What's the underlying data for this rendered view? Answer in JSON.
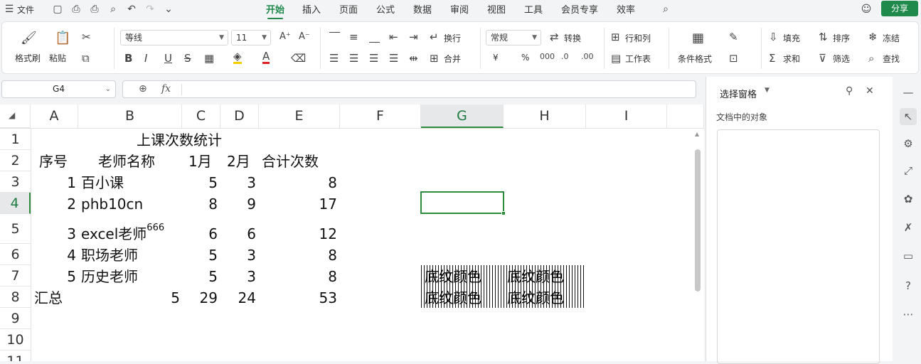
{
  "topbar": {
    "menu_icon": "menu-icon",
    "file_label": "文件",
    "tabs": [
      "开始",
      "插入",
      "页面",
      "公式",
      "数据",
      "审阅",
      "视图",
      "工具",
      "会员专享",
      "效率"
    ],
    "active_tab": "开始",
    "share_label": "分享"
  },
  "ribbon": {
    "format_painter": "格式刷",
    "paste": "粘贴",
    "font_name": "等线",
    "font_size": "11",
    "wrap": "换行",
    "merge": "合并",
    "number_format": "常规",
    "convert": "转换",
    "row_col": "行和列",
    "worksheet": "工作表",
    "cond_format": "条件格式",
    "fill": "填充",
    "sort": "排序",
    "freeze": "冻结",
    "sum": "求和",
    "filter": "筛选",
    "find": "查找",
    "currency": "¥",
    "percent": "%"
  },
  "formula": {
    "cell_ref": "G4",
    "fx": "fx",
    "value": ""
  },
  "sheet": {
    "columns": [
      "A",
      "B",
      "C",
      "D",
      "E",
      "F",
      "G",
      "H",
      "I"
    ],
    "selected_column": "G",
    "rows": [
      "1",
      "2",
      "3",
      "4",
      "5",
      "6",
      "7",
      "8",
      "9",
      "10",
      "11"
    ],
    "selected_row": "4",
    "title": "上课次数统计",
    "headers": [
      "序号",
      "老师名称",
      "1月",
      "2月",
      "合计次数"
    ],
    "data": [
      {
        "no": "1",
        "name": "百小课",
        "m1": "5",
        "m2": "3",
        "total": "8"
      },
      {
        "no": "2",
        "name": "phb10cn",
        "m1": "8",
        "m2": "9",
        "total": "17"
      },
      {
        "no": "3",
        "name": "excel老师",
        "sup": "666",
        "m1": "6",
        "m2": "6",
        "total": "12"
      },
      {
        "no": "4",
        "name": "职场老师",
        "m1": "5",
        "m2": "3",
        "total": "8"
      },
      {
        "no": "5",
        "name": "历史老师",
        "m1": "5",
        "m2": "3",
        "total": "8"
      }
    ],
    "summary": {
      "label": "汇总",
      "b": "5",
      "c": "29",
      "d": "24",
      "e": "53"
    },
    "pattern_text": "底纹颜色"
  },
  "panel": {
    "title": "选择窗格",
    "subtitle": "文档中的对象"
  }
}
